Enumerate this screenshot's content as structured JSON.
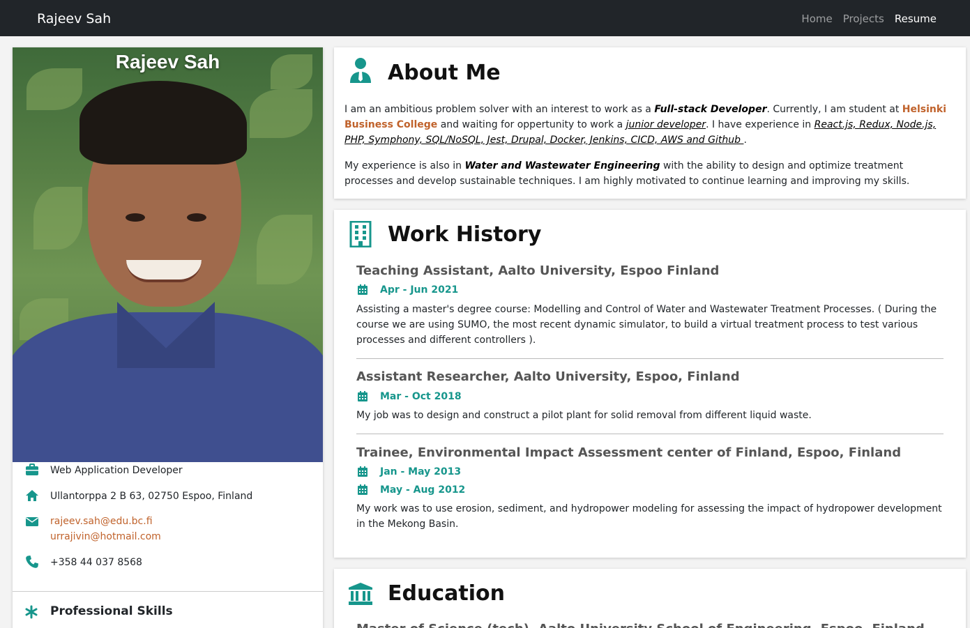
{
  "nav": {
    "brand": "Rajeev Sah",
    "links": [
      "Home",
      "Projects",
      "Resume"
    ],
    "active": "Resume"
  },
  "profile": {
    "name": "Rajeev Sah",
    "role": "Web Application Developer",
    "address": "Ullantorppa 2 B 63, 02750 Espoo, Finland",
    "emails": [
      "rajeev.sah@edu.bc.fi",
      "urrajivin@hotmail.com"
    ],
    "phone": "+358 44 037 8568",
    "skills_title": "Professional Skills"
  },
  "about": {
    "title": "About Me",
    "p1": {
      "t1": "I am an ambitious problem solver with an interest to work as a ",
      "role": "Full-stack Developer",
      "t2": ". Currently, I am student at ",
      "school": "Helsinki Business College",
      "t3": " and waiting for oppertunity to work a ",
      "junior": "junior developer",
      "t4": ". I have experience in ",
      "skills": "React.js, Redux, Node.js, PHP, Symphony, SQL/NoSQL, Jest, Drupal, Docker, Jenkins, CICD, AWS and Github ",
      "t5": "."
    },
    "p2": {
      "t1": "My experience is also in ",
      "field": "Water and Wastewater Engineering",
      "t2": " with the ability to design and optimize treatment processes and develop sustainable techniques. I am highly motivated to continue learning and improving my skills."
    }
  },
  "work": {
    "title": "Work History",
    "jobs": [
      {
        "title": "Teaching Assistant, Aalto University, Espoo Finland",
        "dates": [
          "Apr - Jun 2021"
        ],
        "desc": "Assisting a master's degree course: Modelling and Control of Water and Wastewater Treatment Processes. ( During the course we are using SUMO, the most recent dynamic simulator, to build a virtual treatment process to test various processes and different controllers )."
      },
      {
        "title": "Assistant Researcher, Aalto University, Espoo, Finland",
        "dates": [
          "Mar - Oct 2018"
        ],
        "desc": "My job was to design and construct a pilot plant for solid removal from different liquid waste."
      },
      {
        "title": "Trainee, Environmental Impact Assessment center of Finland, Espoo, Finland",
        "dates": [
          "Jan - May 2013",
          "May - Aug 2012"
        ],
        "desc": "My work was to use erosion, sediment, and hydropower modeling for assessing the impact of hydropower development in the Mekong Basin."
      }
    ]
  },
  "education": {
    "title": "Education",
    "first_entry": "Master of Science (tech), Aalto University School of Engineering, Espoo, Finland"
  },
  "icons": {
    "accent": "#17968c",
    "link": "#c0622b",
    "names": [
      "user-tie-icon",
      "building-icon",
      "university-icon",
      "briefcase-icon",
      "home-icon",
      "envelope-icon",
      "phone-icon",
      "asterisk-icon",
      "calendar-icon"
    ]
  }
}
